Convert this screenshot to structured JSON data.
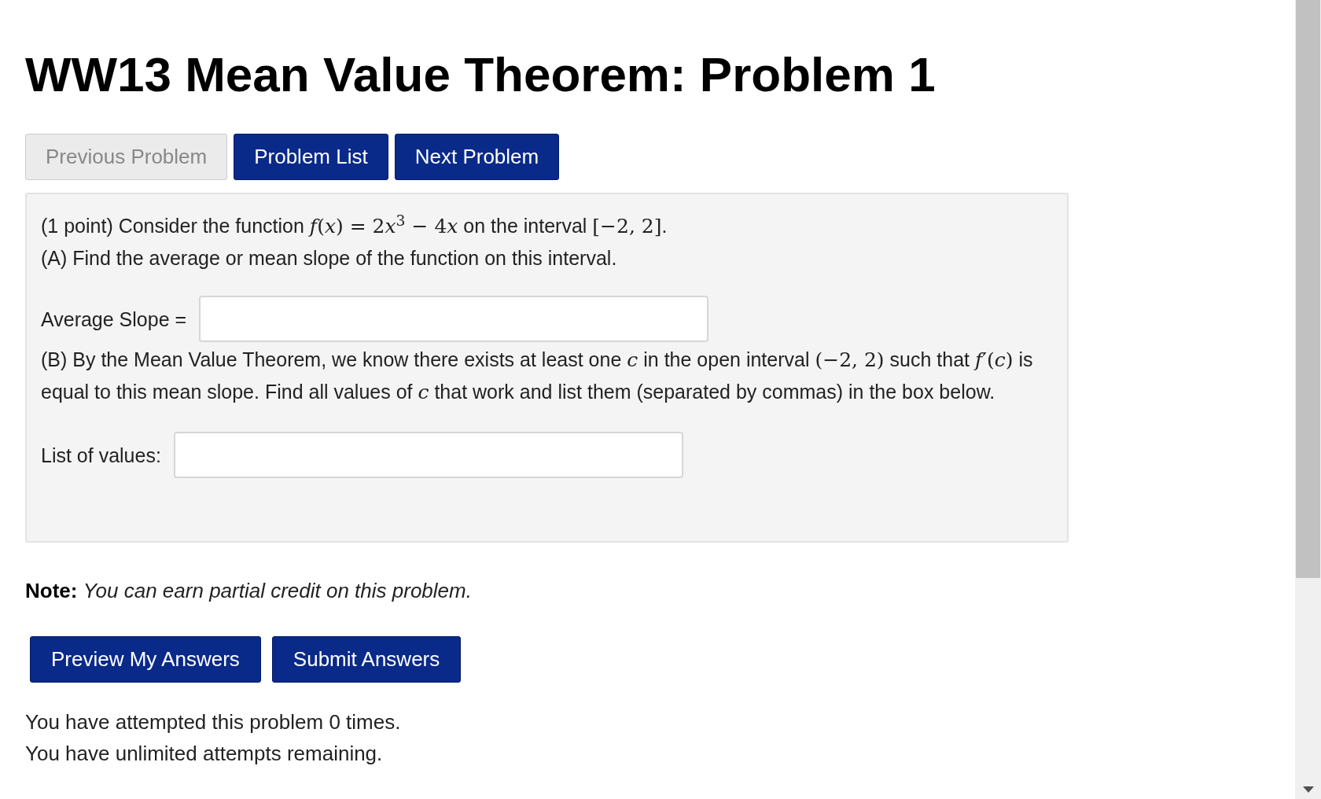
{
  "title": "WW13 Mean Value Theorem: Problem 1",
  "nav_buttons": [
    {
      "label": "Previous Problem",
      "disabled": true
    },
    {
      "label": "Problem List",
      "disabled": false
    },
    {
      "label": "Next Problem",
      "disabled": false
    }
  ],
  "problem": {
    "blocks": [
      {
        "kind": "text",
        "segments": [
          {
            "kind": "text",
            "text": "(1 point) Consider the function "
          },
          {
            "kind": "math",
            "text": "*f*(*x*) = 2"
          },
          {
            "kind": "math",
            "text": "*x*$^{3}$ − 4"
          },
          {
            "kind": "math",
            "text": "*x*"
          },
          {
            "kind": "text",
            "text": " on the interval "
          },
          {
            "kind": "math",
            "text": "[−2, 2]"
          },
          {
            "kind": "text",
            "text": "."
          }
        ]
      },
      {
        "kind": "text",
        "segments": [
          {
            "kind": "text",
            "text": "(A) Find the average or mean slope of the function on this interval."
          }
        ]
      },
      {
        "kind": "field",
        "label": "Average Slope ="
      },
      {
        "kind": "text",
        "segments": [
          {
            "kind": "text",
            "text": "(B) By the Mean Value Theorem, we know there exists at least one "
          },
          {
            "kind": "math",
            "text": "*c*"
          },
          {
            "kind": "text",
            "text": " in the open interval "
          },
          {
            "kind": "math",
            "text": "(−2, 2)"
          },
          {
            "kind": "text",
            "text": " such that "
          },
          {
            "kind": "math",
            "text": "*f*′(*c*)"
          },
          {
            "kind": "text",
            "text": " is equal to this mean slope. Find all values of "
          },
          {
            "kind": "math",
            "text": "*c*"
          },
          {
            "kind": "text",
            "text": " that work and list them (separated by commas) in the box below."
          }
        ]
      },
      {
        "kind": "field",
        "label": "List of values:"
      }
    ]
  },
  "note": {
    "label": "Note:",
    "text": "You can earn partial credit on this problem."
  },
  "action_buttons": [
    "Preview My Answers",
    "Submit Answers"
  ],
  "attempts": [
    "You have attempted this problem 0 times.",
    "You have unlimited attempts remaining."
  ]
}
